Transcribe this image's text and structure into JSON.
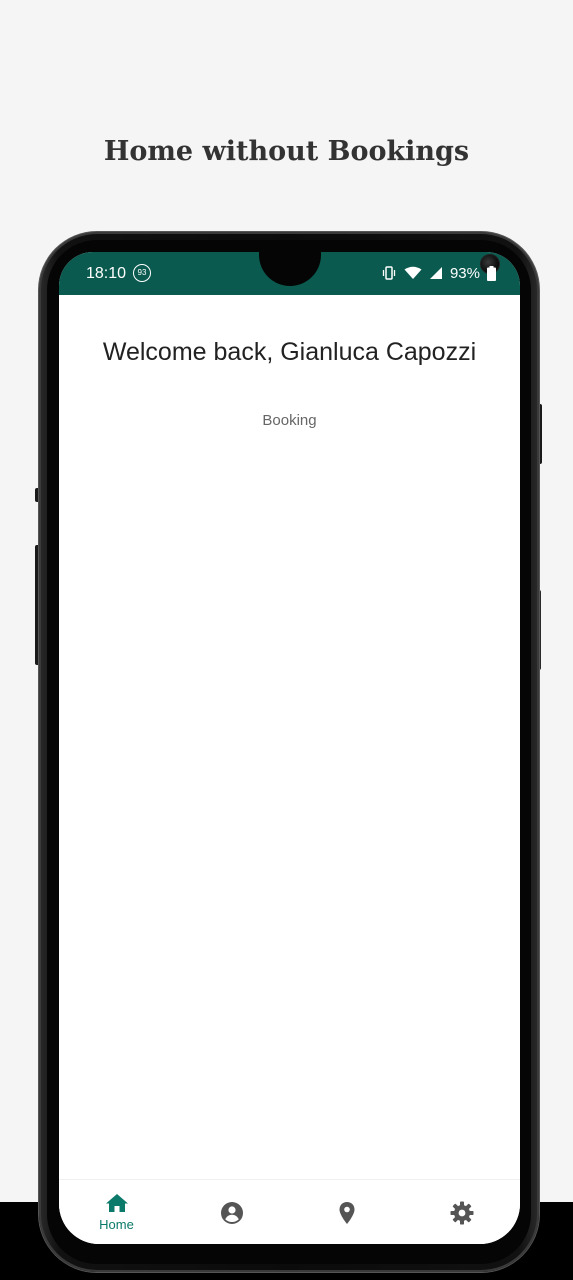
{
  "page": {
    "title": "Home without Bookings"
  },
  "status_bar": {
    "time": "18:10",
    "badge": "93",
    "battery_percent": "93%"
  },
  "main": {
    "welcome": "Welcome back, Gianluca Capozzi",
    "booking_label": "Booking"
  },
  "bottom_nav": {
    "items": [
      {
        "id": "home",
        "label": "Home",
        "icon": "home-icon",
        "active": true
      },
      {
        "id": "profile",
        "label": "",
        "icon": "account-circle-icon",
        "active": false
      },
      {
        "id": "location",
        "label": "",
        "icon": "location-pin-icon",
        "active": false
      },
      {
        "id": "settings",
        "label": "",
        "icon": "gear-icon",
        "active": false
      }
    ]
  },
  "colors": {
    "accent": "#0b7a6a",
    "status_bar": "#0b5a4f",
    "inactive_icon": "#555555",
    "page_background": "#f5f5f5"
  }
}
